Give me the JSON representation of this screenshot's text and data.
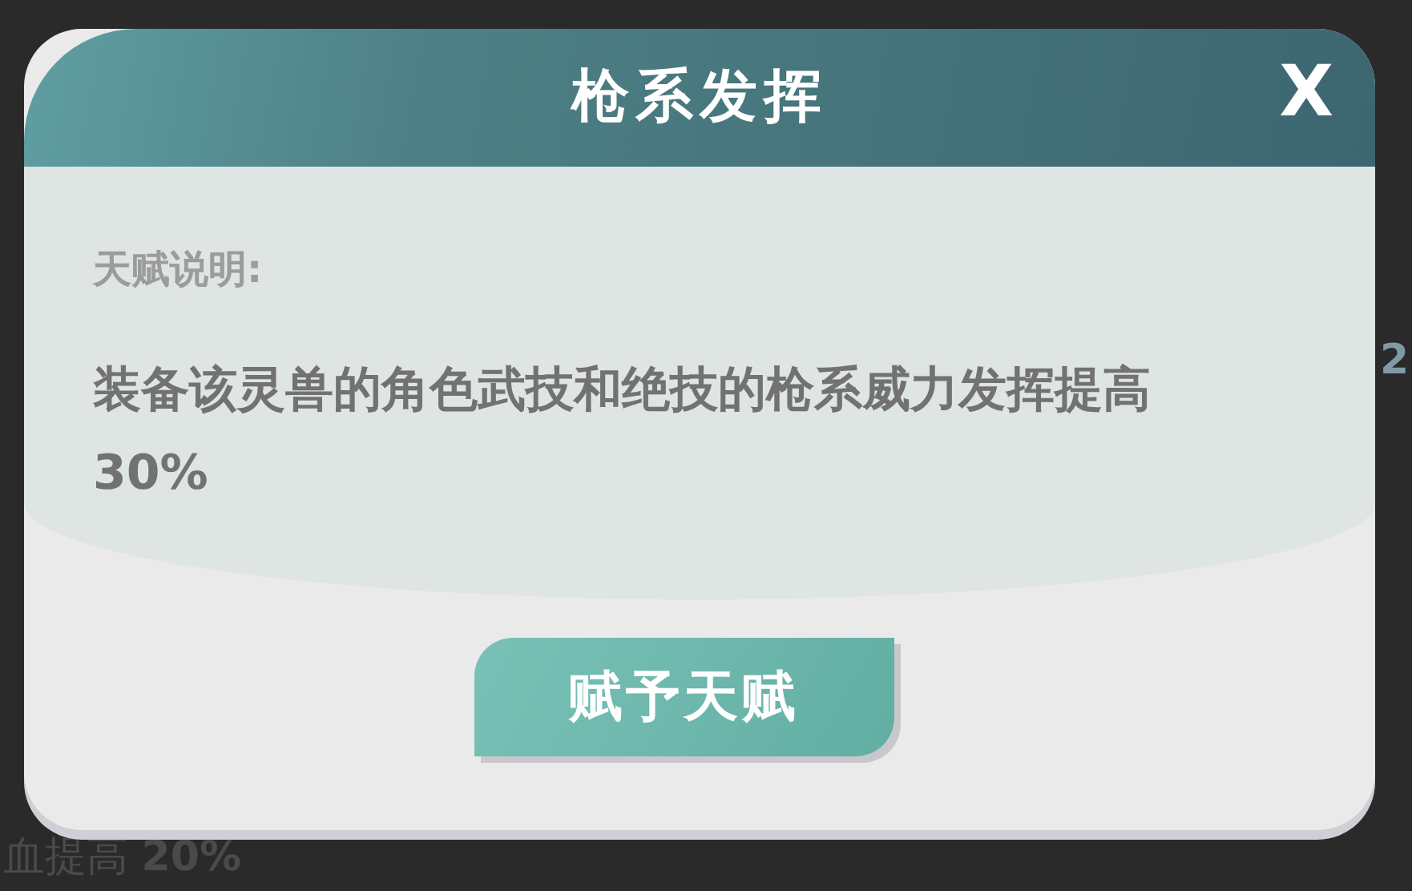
{
  "background": {
    "stat_value": "2",
    "bonus_text": "血提高 **20%**"
  },
  "dialog": {
    "title": "枪系发挥",
    "close_label": "X",
    "section_label": "天赋说明:",
    "description": "装备该灵兽的角色武技和绝技的枪系威力发挥提高 30%",
    "button": "赋予天赋"
  }
}
